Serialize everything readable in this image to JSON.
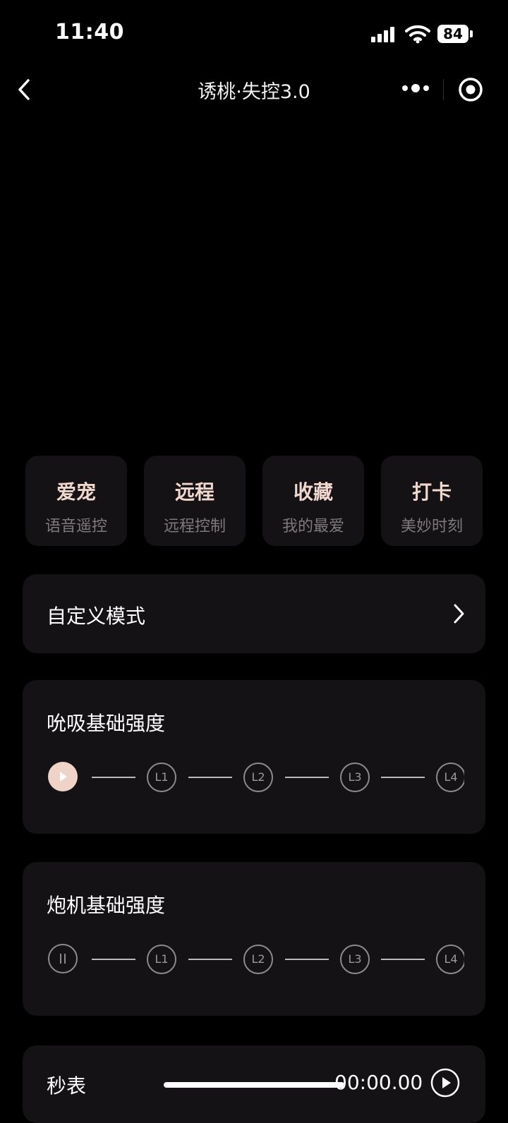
{
  "status_bar": {
    "time": "11:40",
    "battery": "84"
  },
  "nav": {
    "title": "诱桃·失控3.0"
  },
  "quick_actions": [
    {
      "title": "爱宠",
      "subtitle": "语音遥控"
    },
    {
      "title": "远程",
      "subtitle": "远程控制"
    },
    {
      "title": "收藏",
      "subtitle": "我的最爱"
    },
    {
      "title": "打卡",
      "subtitle": "美妙时刻"
    }
  ],
  "custom_mode": {
    "label": "自定义模式"
  },
  "suck_strength": {
    "title": "吮吸基础强度",
    "levels": [
      "L1",
      "L2",
      "L3",
      "L4"
    ]
  },
  "thrust_strength": {
    "title": "炮机基础强度",
    "levels": [
      "L1",
      "L2",
      "L3",
      "L4"
    ]
  },
  "stopwatch": {
    "label": "秒表",
    "time": "00:00.00"
  },
  "colors": {
    "accent": "#f0d3c7",
    "card_bg": "#141214",
    "background": "#000000"
  }
}
